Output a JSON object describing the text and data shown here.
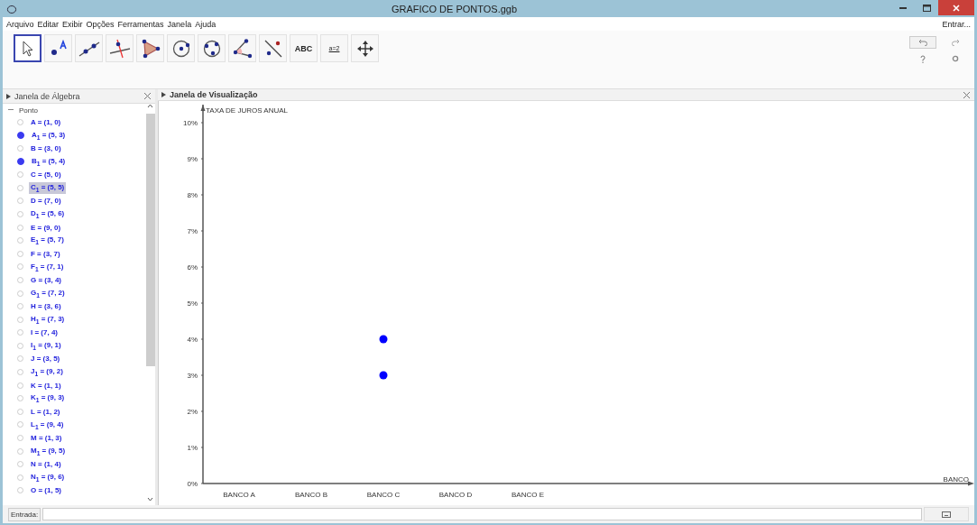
{
  "window": {
    "title": "GRAFICO DE PONTOS.ggb"
  },
  "menu": [
    "Arquivo",
    "Editar",
    "Exibir",
    "Opções",
    "Ferramentas",
    "Janela",
    "Ajuda"
  ],
  "sign_in": "Entrar...",
  "tools": [
    {
      "kind": "move",
      "selected": true
    },
    {
      "kind": "point",
      "selected": false
    },
    {
      "kind": "line",
      "selected": false
    },
    {
      "kind": "perpendicular",
      "selected": false
    },
    {
      "kind": "polygon",
      "selected": false
    },
    {
      "kind": "circle",
      "selected": false
    },
    {
      "kind": "circle3",
      "selected": false
    },
    {
      "kind": "angle",
      "selected": false
    },
    {
      "kind": "reflect",
      "selected": false
    },
    {
      "kind": "text",
      "label": "ABC",
      "selected": false
    },
    {
      "kind": "slider",
      "label": "a=2",
      "selected": false
    },
    {
      "kind": "pan",
      "selected": false
    }
  ],
  "algebra": {
    "title": "Janela de Álgebra",
    "group": "Ponto",
    "items": [
      {
        "label": "A = (1, 0)",
        "shown": false,
        "selected": false
      },
      {
        "label": "A$_{1}$ = (5, 3)",
        "shown": true,
        "selected": false
      },
      {
        "label": "B = (3, 0)",
        "shown": false,
        "selected": false
      },
      {
        "label": "B$_{1}$ = (5, 4)",
        "shown": true,
        "selected": false
      },
      {
        "label": "C = (5, 0)",
        "shown": false,
        "selected": false
      },
      {
        "label": "C$_{1}$ = (5, 5)",
        "shown": false,
        "selected": true
      },
      {
        "label": "D = (7, 0)",
        "shown": false,
        "selected": false
      },
      {
        "label": "D$_{1}$ = (5, 6)",
        "shown": false,
        "selected": false
      },
      {
        "label": "E = (9, 0)",
        "shown": false,
        "selected": false
      },
      {
        "label": "E$_{1}$ = (5, 7)",
        "shown": false,
        "selected": false
      },
      {
        "label": "F = (3, 7)",
        "shown": false,
        "selected": false
      },
      {
        "label": "F$_{1}$ = (7, 1)",
        "shown": false,
        "selected": false
      },
      {
        "label": "G = (3, 4)",
        "shown": false,
        "selected": false
      },
      {
        "label": "G$_{1}$ = (7, 2)",
        "shown": false,
        "selected": false
      },
      {
        "label": "H = (3, 6)",
        "shown": false,
        "selected": false
      },
      {
        "label": "H$_{1}$ = (7, 3)",
        "shown": false,
        "selected": false
      },
      {
        "label": "I = (7, 4)",
        "shown": false,
        "selected": false
      },
      {
        "label": "I$_{1}$ = (9, 1)",
        "shown": false,
        "selected": false
      },
      {
        "label": "J = (3, 5)",
        "shown": false,
        "selected": false
      },
      {
        "label": "J$_{1}$ = (9, 2)",
        "shown": false,
        "selected": false
      },
      {
        "label": "K = (1, 1)",
        "shown": false,
        "selected": false
      },
      {
        "label": "K$_{1}$ = (9, 3)",
        "shown": false,
        "selected": false
      },
      {
        "label": "L = (1, 2)",
        "shown": false,
        "selected": false
      },
      {
        "label": "L$_{1}$ = (9, 4)",
        "shown": false,
        "selected": false
      },
      {
        "label": "M = (1, 3)",
        "shown": false,
        "selected": false
      },
      {
        "label": "M$_{1}$ = (9, 5)",
        "shown": false,
        "selected": false
      },
      {
        "label": "N = (1, 4)",
        "shown": false,
        "selected": false
      },
      {
        "label": "N$_{1}$ = (9, 6)",
        "shown": false,
        "selected": false
      },
      {
        "label": "O = (1, 5)",
        "shown": false,
        "selected": false
      }
    ]
  },
  "graphics": {
    "title": "Janela de Visualização",
    "chart_data": {
      "type": "scatter",
      "ylabel": "TAXA DE JUROS ANUAL",
      "annotations": [
        {
          "text": "BANCO"
        }
      ],
      "categories": [
        "BANCO A",
        "BANCO B",
        "BANCO C",
        "BANCO D",
        "BANCO E"
      ],
      "series": [
        {
          "color": "#0000ff",
          "values": [
            null,
            null,
            3,
            null,
            null
          ]
        },
        {
          "color": "#0000ff",
          "values": [
            null,
            null,
            4,
            null,
            null
          ]
        }
      ],
      "ylim": [
        0,
        10.5
      ],
      "yticks": [
        {
          "value": 0,
          "label": "0%"
        },
        {
          "value": 1,
          "label": "1%"
        },
        {
          "value": 2,
          "label": "2%"
        },
        {
          "value": 3,
          "label": "3%"
        },
        {
          "value": 4,
          "label": "4%"
        },
        {
          "value": 5,
          "label": "5%"
        },
        {
          "value": 6,
          "label": "6%"
        },
        {
          "value": 7,
          "label": "7%"
        },
        {
          "value": 8,
          "label": "8%"
        },
        {
          "value": 9,
          "label": "9%"
        },
        {
          "value": 10,
          "label": "10%"
        }
      ]
    }
  },
  "input_bar": {
    "label": "Entrada:"
  }
}
